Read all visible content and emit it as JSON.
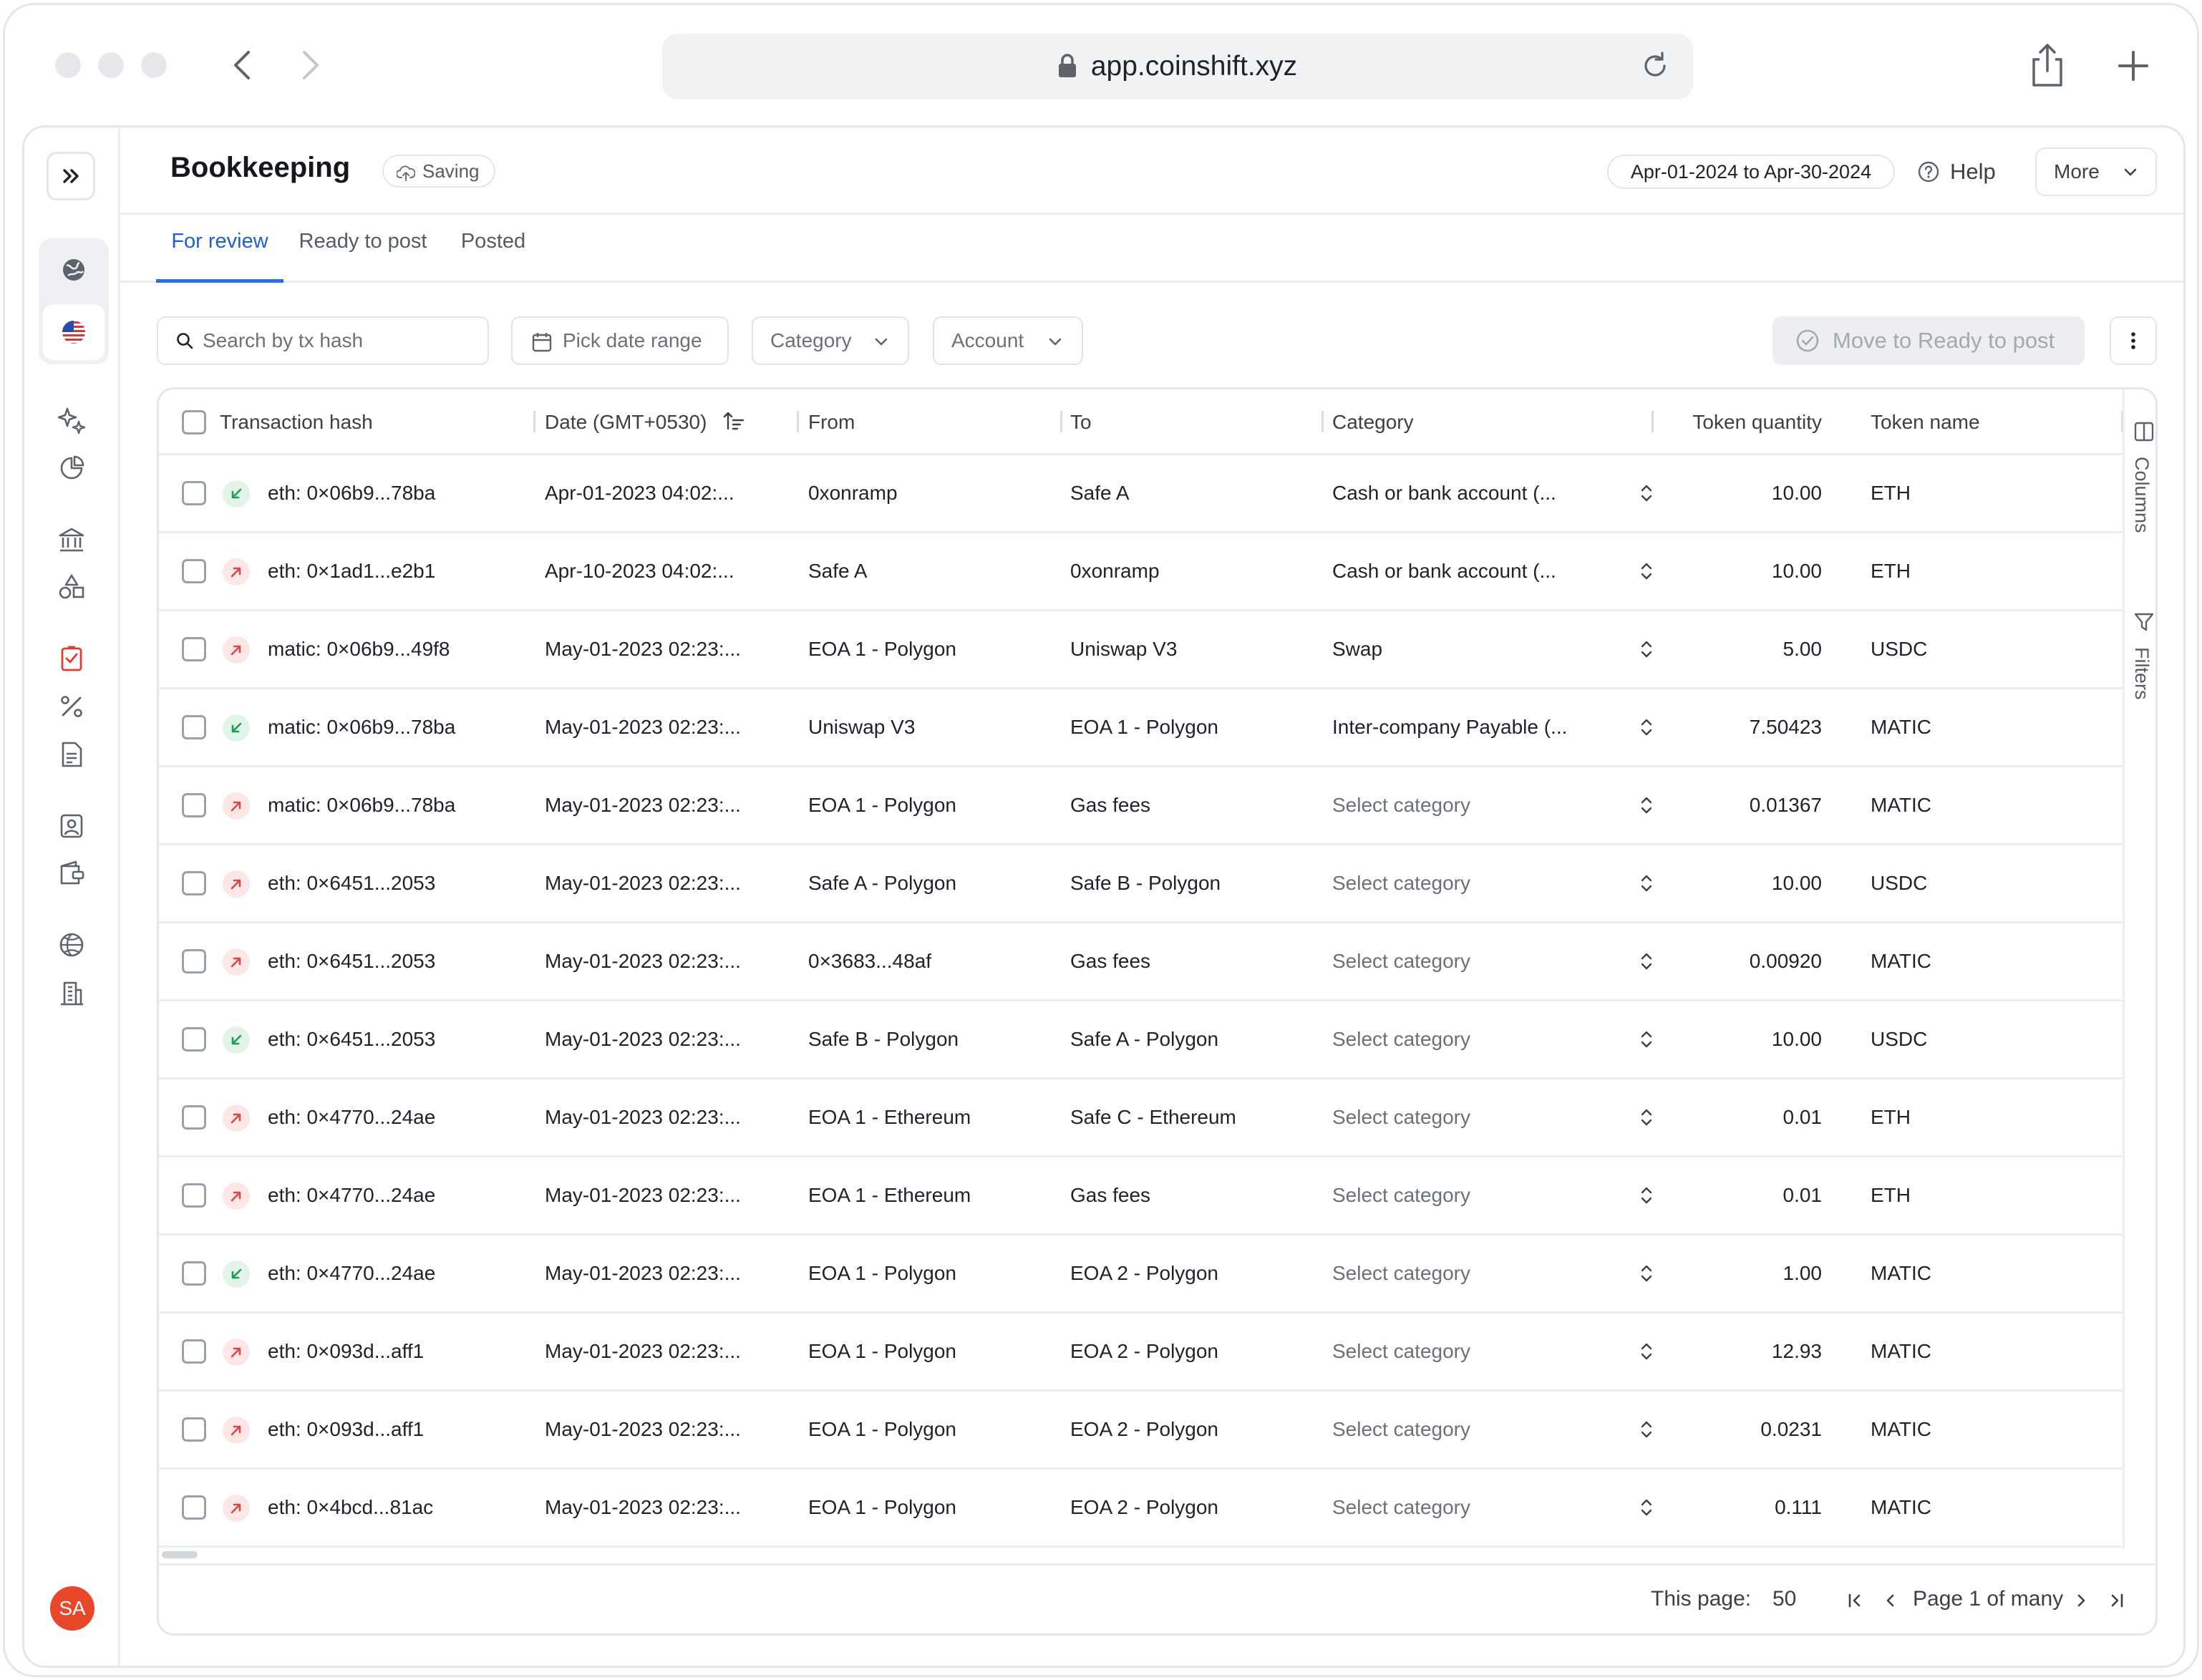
{
  "browser": {
    "url": "app.coinshift.xyz"
  },
  "sidebar": {
    "avatar_initials": "SA",
    "avatar_color": "#e8472a",
    "icons": [
      "globe-icon",
      "us-flag-icon",
      "sparkles-icon",
      "pie-chart-icon",
      "bank-icon",
      "shapes-icon",
      "checklist-icon",
      "percent-icon",
      "invoice-icon",
      "contact-icon",
      "wallet-icon",
      "basketball-icon",
      "building-icon"
    ]
  },
  "header": {
    "title": "Bookkeeping",
    "saving_label": "Saving",
    "date_range": "Apr-01-2024 to Apr-30-2024",
    "help_label": "Help",
    "more_label": "More"
  },
  "tabs": [
    {
      "label": "For review",
      "active": true
    },
    {
      "label": "Ready to post",
      "active": false
    },
    {
      "label": "Posted",
      "active": false
    }
  ],
  "toolbar": {
    "search_placeholder": "Search by tx hash",
    "date_picker_label": "Pick date range",
    "category_filter_label": "Category",
    "account_filter_label": "Account",
    "move_button_label": "Move to Ready to post"
  },
  "table": {
    "headers": {
      "hash": "Transaction hash",
      "date": "Date (GMT+0530)",
      "from": "From",
      "to": "To",
      "category": "Category",
      "quantity": "Token quantity",
      "token": "Token name"
    },
    "rows": [
      {
        "dir": "in",
        "hash": "eth: 0×06b9...78ba",
        "date": "Apr-01-2023 04:02:...",
        "from": "0xonramp",
        "to": "Safe A",
        "category": "Cash or bank account (...",
        "category_set": true,
        "quantity": "10.00",
        "token": "ETH"
      },
      {
        "dir": "out",
        "hash": "eth: 0×1ad1...e2b1",
        "date": "Apr-10-2023 04:02:...",
        "from": "Safe A",
        "to": "0xonramp",
        "category": "Cash or bank account (...",
        "category_set": true,
        "quantity": "10.00",
        "token": "ETH"
      },
      {
        "dir": "out",
        "hash": "matic: 0×06b9...49f8",
        "date": "May-01-2023 02:23:...",
        "from": "EOA 1 - Polygon",
        "to": "Uniswap V3",
        "category": "Swap",
        "category_set": true,
        "quantity": "5.00",
        "token": "USDC"
      },
      {
        "dir": "in",
        "hash": "matic: 0×06b9...78ba",
        "date": "May-01-2023 02:23:...",
        "from": "Uniswap V3",
        "to": "EOA 1 - Polygon",
        "category": "Inter-company Payable (...",
        "category_set": true,
        "quantity": "7.50423",
        "token": "MATIC"
      },
      {
        "dir": "out",
        "hash": "matic: 0×06b9...78ba",
        "date": "May-01-2023 02:23:...",
        "from": "EOA 1 - Polygon",
        "to": "Gas fees",
        "category": "Select category",
        "category_set": false,
        "quantity": "0.01367",
        "token": "MATIC"
      },
      {
        "dir": "out",
        "hash": "eth: 0×6451...2053",
        "date": "May-01-2023 02:23:...",
        "from": "Safe A - Polygon",
        "to": "Safe B - Polygon",
        "category": "Select category",
        "category_set": false,
        "quantity": "10.00",
        "token": "USDC"
      },
      {
        "dir": "out",
        "hash": "eth: 0×6451...2053",
        "date": "May-01-2023 02:23:...",
        "from": "0×3683...48af",
        "to": "Gas fees",
        "category": "Select category",
        "category_set": false,
        "quantity": "0.00920",
        "token": "MATIC"
      },
      {
        "dir": "in",
        "hash": "eth: 0×6451...2053",
        "date": "May-01-2023 02:23:...",
        "from": "Safe B - Polygon",
        "to": "Safe A - Polygon",
        "category": "Select category",
        "category_set": false,
        "quantity": "10.00",
        "token": "USDC"
      },
      {
        "dir": "out",
        "hash": "eth: 0×4770...24ae",
        "date": "May-01-2023 02:23:...",
        "from": "EOA 1 - Ethereum",
        "to": "Safe C - Ethereum",
        "category": "Select category",
        "category_set": false,
        "quantity": "0.01",
        "token": "ETH"
      },
      {
        "dir": "out",
        "hash": "eth: 0×4770...24ae",
        "date": "May-01-2023 02:23:...",
        "from": "EOA 1 - Ethereum",
        "to": "Gas fees",
        "category": "Select category",
        "category_set": false,
        "quantity": "0.01",
        "token": "ETH"
      },
      {
        "dir": "in",
        "hash": "eth: 0×4770...24ae",
        "date": "May-01-2023 02:23:...",
        "from": "EOA 1 - Polygon",
        "to": "EOA 2 - Polygon",
        "category": "Select category",
        "category_set": false,
        "quantity": "1.00",
        "token": "MATIC"
      },
      {
        "dir": "out",
        "hash": "eth: 0×093d...aff1",
        "date": "May-01-2023 02:23:...",
        "from": "EOA 1 - Polygon",
        "to": "EOA 2 - Polygon",
        "category": "Select category",
        "category_set": false,
        "quantity": "12.93",
        "token": "MATIC"
      },
      {
        "dir": "out",
        "hash": "eth: 0×093d...aff1",
        "date": "May-01-2023 02:23:...",
        "from": "EOA 1 - Polygon",
        "to": "EOA 2 - Polygon",
        "category": "Select category",
        "category_set": false,
        "quantity": "0.0231",
        "token": "MATIC"
      },
      {
        "dir": "out",
        "hash": "eth: 0×4bcd...81ac",
        "date": "May-01-2023 02:23:...",
        "from": "EOA 1 - Polygon",
        "to": "EOA 2 - Polygon",
        "category": "Select category",
        "category_set": false,
        "quantity": "0.111",
        "token": "MATIC"
      }
    ]
  },
  "side_panel": {
    "columns_label": "Columns",
    "filters_label": "Filters"
  },
  "pagination": {
    "page_size_label": "This page:",
    "page_size_value": "50",
    "page_label": "Page 1 of many"
  },
  "colors": {
    "accent": "#2e6be6",
    "incoming": "#1f9d55",
    "outgoing": "#d94848"
  }
}
